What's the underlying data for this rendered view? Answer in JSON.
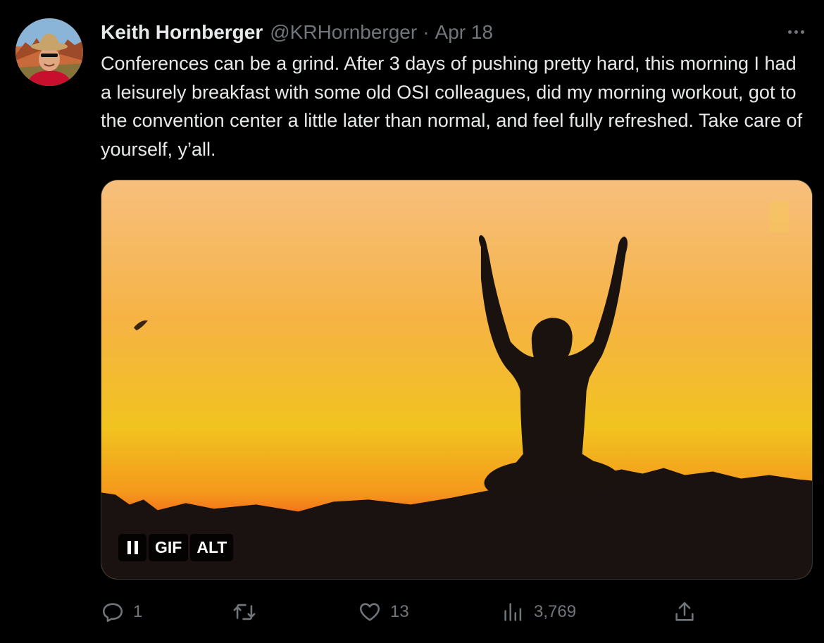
{
  "author": {
    "name": "Keith Hornberger",
    "handle": "@KRHornberger",
    "separator": "·",
    "date": "Apr 18"
  },
  "tweet": {
    "text": "Conferences can be a grind. After 3 days of pushing pretty hard, this morning I had a leisurely breakfast with some old OSI colleagues, did my morning workout, got to the convention center a little later than normal, and feel fully refreshed. Take care of yourself, y’all."
  },
  "media": {
    "badge_gif": "GIF",
    "badge_alt": "ALT"
  },
  "actions": {
    "replies": "1",
    "retweets": "",
    "likes": "13",
    "views": "3,769"
  },
  "icons": {
    "more": "more-horizontal-icon",
    "reply": "reply-icon",
    "retweet": "retweet-icon",
    "like": "heart-icon",
    "views": "views-chart-icon",
    "share": "share-icon",
    "pause": "pause-icon"
  },
  "colors": {
    "background": "#000000",
    "text": "#e7e9ea",
    "secondary": "#71767b"
  }
}
